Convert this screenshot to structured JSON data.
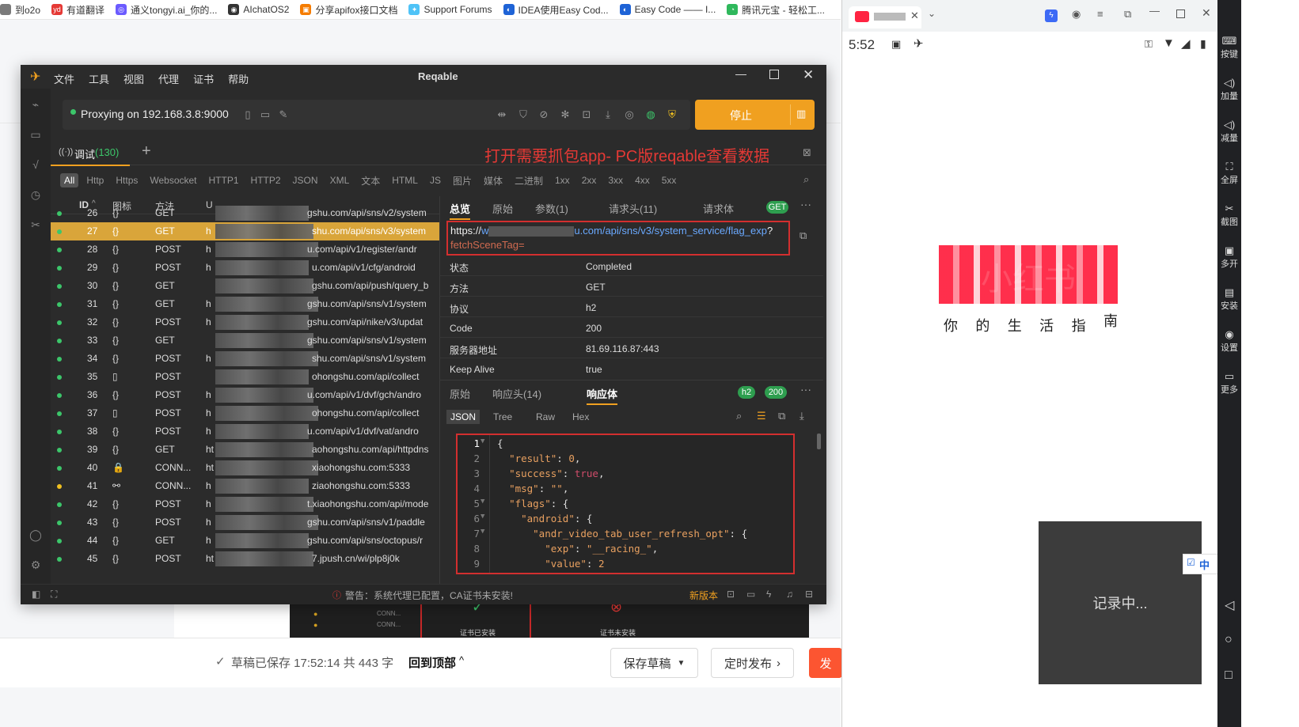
{
  "bookmarks": [
    {
      "label": "到o2o",
      "color": "#7a7a7a",
      "glyph": ""
    },
    {
      "label": "有道翻译",
      "color": "#e53935",
      "glyph": "yd"
    },
    {
      "label": "通义tongyi.ai_你的...",
      "color": "#6b5bff",
      "glyph": "◎"
    },
    {
      "label": "AIchatOS2",
      "color": "#333333",
      "glyph": "◉"
    },
    {
      "label": "分享apifox接口文档",
      "color": "#f57c00",
      "glyph": "▣"
    },
    {
      "label": "Support Forums",
      "color": "#4fc3f7",
      "glyph": "✦"
    },
    {
      "label": "IDEA使用Easy Cod...",
      "color": "#1e63d6",
      "glyph": "◐"
    },
    {
      "label": "Easy Code —— I...",
      "color": "#1e63d6",
      "glyph": "◐"
    },
    {
      "label": "腾讯元宝 - 轻松工...",
      "color": "#2fb85c",
      "glyph": "◔"
    }
  ],
  "bottom_bar": {
    "save_status": "草稿已保存 17:52:14 共 443 字",
    "back_to_top": "回到顶部",
    "save_draft": "保存草稿",
    "schedule": "定时发布",
    "publish": "发"
  },
  "reqable": {
    "title": "Reqable",
    "menu": [
      "文件",
      "工具",
      "视图",
      "代理",
      "证书",
      "帮助"
    ],
    "proxy_status": "Proxying on 192.168.3.8:9000",
    "stop_label": "停止",
    "tab_label": "调试",
    "tab_count": "(130)",
    "annotation": "打开需要抓包app- PC版reqable查看数据",
    "filters": [
      "All",
      "Http",
      "Https",
      "Websocket",
      "HTTP1",
      "HTTP2",
      "JSON",
      "XML",
      "文本",
      "HTML",
      "JS",
      "图片",
      "媒体",
      "二进制",
      "1xx",
      "2xx",
      "3xx",
      "4xx",
      "5xx"
    ],
    "columns": {
      "id": "ID",
      "icon": "图标",
      "method": "方法",
      "url": "U"
    },
    "rows": [
      {
        "id": "26",
        "icon": "{}",
        "method": "GET",
        "url_prefix": "",
        "url_suffix": "gshu.com/api/sns/v2/system",
        "dot": "green",
        "selected": false
      },
      {
        "id": "27",
        "icon": "{}",
        "method": "GET",
        "url_prefix": "h",
        "url_suffix": "shu.com/api/sns/v3/system",
        "dot": "green",
        "selected": true
      },
      {
        "id": "28",
        "icon": "{}",
        "method": "POST",
        "url_prefix": "h",
        "url_suffix": "u.com/api/v1/register/andr",
        "dot": "green",
        "selected": false
      },
      {
        "id": "29",
        "icon": "{}",
        "method": "POST",
        "url_prefix": "h",
        "url_suffix": "u.com/api/v1/cfg/android",
        "dot": "green",
        "selected": false
      },
      {
        "id": "30",
        "icon": "{}",
        "method": "GET",
        "url_prefix": "",
        "url_suffix": "gshu.com/api/push/query_b",
        "dot": "green",
        "selected": false
      },
      {
        "id": "31",
        "icon": "{}",
        "method": "GET",
        "url_prefix": "h",
        "url_suffix": "gshu.com/api/sns/v1/system",
        "dot": "green",
        "selected": false
      },
      {
        "id": "32",
        "icon": "{}",
        "method": "POST",
        "url_prefix": "h",
        "url_suffix": "gshu.com/api/nike/v3/updat",
        "dot": "green",
        "selected": false
      },
      {
        "id": "33",
        "icon": "{}",
        "method": "GET",
        "url_prefix": "",
        "url_suffix": "gshu.com/api/sns/v1/system",
        "dot": "green",
        "selected": false
      },
      {
        "id": "34",
        "icon": "{}",
        "method": "POST",
        "url_prefix": "h",
        "url_suffix": "shu.com/api/sns/v1/system",
        "dot": "green",
        "selected": false
      },
      {
        "id": "35",
        "icon": "▯",
        "method": "POST",
        "url_prefix": "",
        "url_suffix": "ohongshu.com/api/collect",
        "dot": "green",
        "selected": false
      },
      {
        "id": "36",
        "icon": "{}",
        "method": "POST",
        "url_prefix": "h",
        "url_suffix": "u.com/api/v1/dvf/gch/andro",
        "dot": "green",
        "selected": false
      },
      {
        "id": "37",
        "icon": "▯",
        "method": "POST",
        "url_prefix": "h",
        "url_suffix": "ohongshu.com/api/collect",
        "dot": "green",
        "selected": false
      },
      {
        "id": "38",
        "icon": "{}",
        "method": "POST",
        "url_prefix": "h",
        "url_suffix": "u.com/api/v1/dvf/vat/andro",
        "dot": "green",
        "selected": false
      },
      {
        "id": "39",
        "icon": "{}",
        "method": "GET",
        "url_prefix": "ht",
        "url_suffix": "aohongshu.com/api/httpdns",
        "dot": "green",
        "selected": false
      },
      {
        "id": "40",
        "icon": "🔒",
        "method": "CONN...",
        "url_prefix": "ht",
        "url_suffix": "xiaohongshu.com:5333",
        "dot": "green",
        "selected": false
      },
      {
        "id": "41",
        "icon": "⚯",
        "method": "CONN...",
        "url_prefix": "h",
        "url_suffix": "ziaohongshu.com:5333",
        "dot": "yellow",
        "selected": false
      },
      {
        "id": "42",
        "icon": "{}",
        "method": "POST",
        "url_prefix": "h",
        "url_suffix": "t.xiaohongshu.com/api/mode",
        "dot": "green",
        "selected": false
      },
      {
        "id": "43",
        "icon": "{}",
        "method": "POST",
        "url_prefix": "h",
        "url_suffix": "gshu.com/api/sns/v1/paddle",
        "dot": "green",
        "selected": false
      },
      {
        "id": "44",
        "icon": "{}",
        "method": "GET",
        "url_prefix": "h",
        "url_suffix": "gshu.com/api/sns/octopus/r",
        "dot": "green",
        "selected": false
      },
      {
        "id": "45",
        "icon": "{}",
        "method": "POST",
        "url_prefix": "ht",
        "url_suffix": "7.jpush.cn/wi/plp8j0k",
        "dot": "green",
        "selected": false
      }
    ],
    "detail": {
      "tabs_top": [
        "总览",
        "原始",
        "参数(1)",
        "请求头(11)",
        "请求体"
      ],
      "method_badge": "GET",
      "url_scheme": "https://",
      "url_host_start": "w",
      "url_host_end": "u.com",
      "url_path": "/api/sns/v3/system_service/flag_exp",
      "url_query_sep": "?",
      "url_query": "fetchSceneTag=",
      "overview": [
        {
          "key": "状态",
          "value": "Completed"
        },
        {
          "key": "方法",
          "value": "GET"
        },
        {
          "key": "协议",
          "value": "h2"
        },
        {
          "key": "Code",
          "value": "200"
        },
        {
          "key": "服务器地址",
          "value": "81.69.116.87:443"
        },
        {
          "key": "Keep Alive",
          "value": "true"
        }
      ],
      "tabs_bottom": [
        "原始",
        "响应头(14)",
        "响应体"
      ],
      "badge_h2": "h2",
      "badge_code": "200",
      "view_modes": [
        "JSON",
        "Tree",
        "Raw",
        "Hex"
      ],
      "json_lines": [
        {
          "n": "1",
          "fold": "▼",
          "text": "{"
        },
        {
          "n": "2",
          "fold": "",
          "text": "  \"result\": 0,"
        },
        {
          "n": "3",
          "fold": "",
          "text": "  \"success\": true,"
        },
        {
          "n": "4",
          "fold": "",
          "text": "  \"msg\": \"\","
        },
        {
          "n": "5",
          "fold": "▼",
          "text": "  \"flags\": {"
        },
        {
          "n": "6",
          "fold": "▼",
          "text": "    \"android\": {"
        },
        {
          "n": "7",
          "fold": "▼",
          "text": "      \"andr_video_tab_user_refresh_opt\": {"
        },
        {
          "n": "8",
          "fold": "",
          "text": "        \"exp\": \"__racing_\","
        },
        {
          "n": "9",
          "fold": "",
          "text": "        \"value\": 2"
        }
      ]
    },
    "status_warning": "警告：系统代理已配置，CA证书未安装!",
    "new_version": "新版本"
  },
  "background_cards": {
    "cert_installed": "证书已安装",
    "cert_not_installed": "证书未安装",
    "conn1": "CONN...",
    "conn2": "CONN..."
  },
  "phone": {
    "time": "5:52",
    "app_logo": "小红书",
    "slogan_chars": [
      "你",
      "的",
      "生",
      "活",
      "指",
      "南"
    ],
    "recording": "记录中...",
    "ime_label": "中"
  },
  "right_rail": [
    "按键",
    "加量",
    "减量",
    "全屏",
    "截图",
    "多开",
    "安装",
    "设置",
    "更多"
  ]
}
